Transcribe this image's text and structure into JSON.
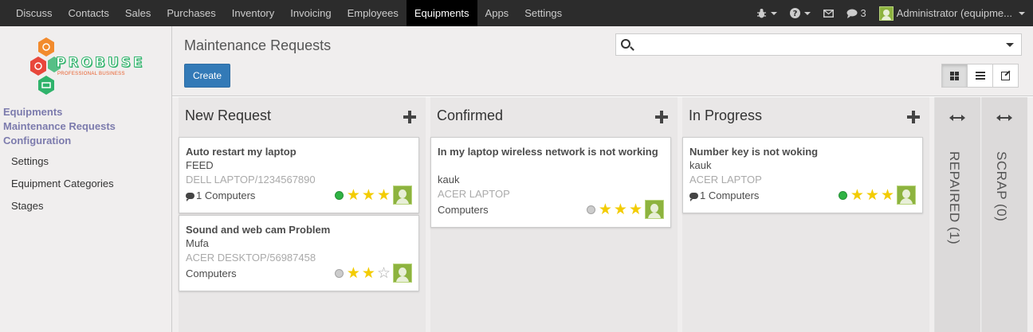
{
  "topbar": {
    "menu": [
      "Discuss",
      "Contacts",
      "Sales",
      "Purchases",
      "Inventory",
      "Invoicing",
      "Employees",
      "Equipments",
      "Apps",
      "Settings"
    ],
    "active": "Equipments",
    "messages_count": "3",
    "user": "Administrator (equipme..."
  },
  "logo": {
    "text": "PROBUSE",
    "sub": "PROFESSIONAL BUSINESS"
  },
  "sidebar": {
    "sections": [
      "Equipments",
      "Maintenance Requests",
      "Configuration"
    ],
    "items": [
      "Settings",
      "Equipment Categories",
      "Stages"
    ]
  },
  "control_panel": {
    "title": "Maintenance Requests",
    "create_label": "Create",
    "search_placeholder": ""
  },
  "columns": [
    {
      "title": "New Request",
      "cards": [
        {
          "name": "Auto restart my laptop",
          "user": "FEED",
          "equipment": "DELL LAPTOP/1234567890",
          "count": "1 Computers",
          "has_comments": true,
          "state_color": "#2fb344",
          "stars": 3
        },
        {
          "name": "Sound and web cam Problem",
          "user": "Mufa",
          "equipment": "ACER DESKTOP/56987458",
          "count": "Computers",
          "has_comments": false,
          "state_color": "#cccccc",
          "stars": 2
        }
      ]
    },
    {
      "title": "Confirmed",
      "cards": [
        {
          "name": "In my laptop wireless network is not working",
          "user": "kauk",
          "equipment": "ACER LAPTOP",
          "count": "Computers",
          "has_comments": false,
          "state_color": "#cccccc",
          "stars": 3
        }
      ]
    },
    {
      "title": "In Progress",
      "cards": [
        {
          "name": "Number key is not woking",
          "user": "kauk",
          "equipment": "ACER LAPTOP",
          "count": "1 Computers",
          "has_comments": true,
          "state_color": "#2fb344",
          "stars": 3
        }
      ]
    }
  ],
  "folded_columns": [
    "REPAIRED (1)",
    "SCRAP (0)"
  ],
  "icons": [
    "bug-icon",
    "help-icon",
    "envelope-icon",
    "comments-icon",
    "search-icon",
    "kanban-view-icon",
    "list-view-icon",
    "form-view-icon",
    "add-icon",
    "expand-icon",
    "star-icon",
    "avatar"
  ]
}
